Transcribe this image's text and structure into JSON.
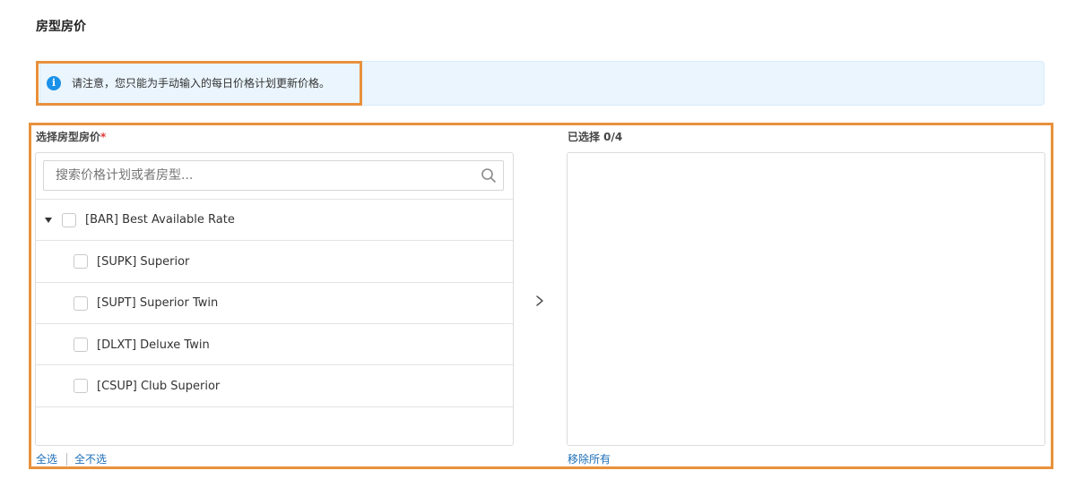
{
  "page": {
    "title": "房型房价"
  },
  "notice": {
    "icon": "info-icon",
    "icon_glyph": "i",
    "text": "请注意，您只能为手动输入的每日价格计划更新价格。",
    "accent_color": "#1a91e9"
  },
  "selector": {
    "left_label": "选择房型房价",
    "required_mark": "*",
    "search_placeholder": "搜索价格计划或者房型...",
    "tree": [
      {
        "label": "[BAR] Best Available Rate",
        "expanded": true,
        "checked": false
      },
      {
        "label": "[SUPK] Superior",
        "checked": false
      },
      {
        "label": "[SUPT] Superior Twin",
        "checked": false
      },
      {
        "label": "[DLXT] Deluxe Twin",
        "checked": false
      },
      {
        "label": "[CSUP] Club Superior",
        "checked": false
      }
    ],
    "select_all": "全选",
    "select_none": "全不选",
    "right_label": "已选择 0/4",
    "remove_all": "移除所有",
    "highlight_color": "#e8913c"
  }
}
